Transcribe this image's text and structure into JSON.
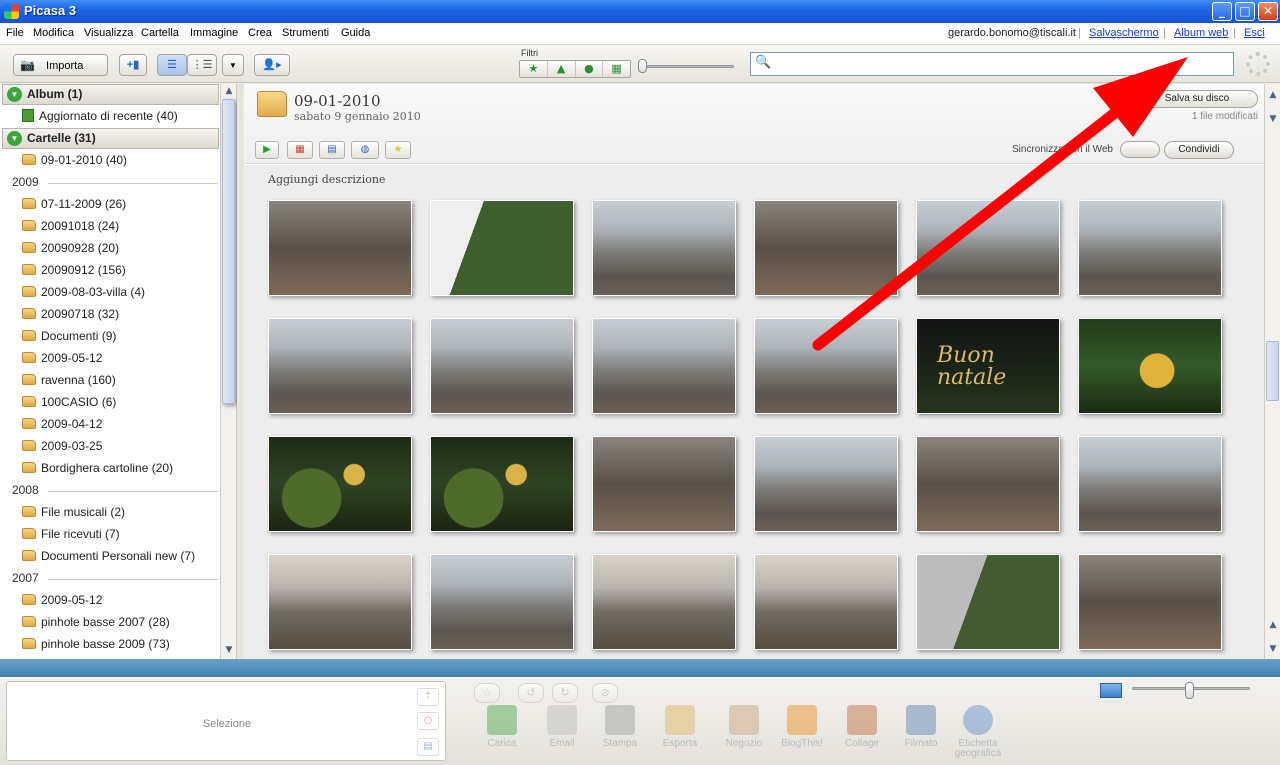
{
  "window": {
    "title": "Picasa 3",
    "minimize": "_",
    "maximize": "□",
    "close": "✕"
  },
  "menu": {
    "items": [
      "File",
      "Modifica",
      "Visualizza",
      "Cartella",
      "Immagine",
      "Crea",
      "Strumenti",
      "Guida"
    ],
    "user": "gerardo.bonomo@tiscali.it",
    "links": [
      "Salvaschermo",
      "Album web",
      "Esci"
    ],
    "separator": "|"
  },
  "toolbar": {
    "import_label": "Importa",
    "filters_label": "Filtri",
    "search": {
      "value": "",
      "placeholder": ""
    }
  },
  "sidebar": {
    "album_section": "Album (1)",
    "album_items": [
      "Aggiornato di recente (40)"
    ],
    "folders_section": "Cartelle (31)",
    "folders_top": [
      "09-01-2010 (40)"
    ],
    "year_2009": "2009",
    "folders_2009": [
      "07-11-2009 (26)",
      "20091018 (24)",
      "20090928 (20)",
      "20090912 (156)",
      "2009-08-03-villa (4)",
      "20090718 (32)",
      "Documenti (9)",
      "2009-05-12",
      "ravenna (160)",
      "100CASIO (6)",
      "2009-04-12",
      "2009-03-25",
      "Bordighera cartoline (20)"
    ],
    "year_2008": "2008",
    "folders_2008": [
      "File musicali (2)",
      "File ricevuti (7)",
      "Documenti Personali new (7)"
    ],
    "year_2007": "2007",
    "folders_2007": [
      "2009-05-12",
      "pinhole basse 2007 (28)",
      "pinhole basse 2009 (73)"
    ]
  },
  "folder": {
    "title": "09-01-2010",
    "date": "sabato 9 gennaio 2010",
    "save_label": "Salva su disco",
    "modified": "1 file modificati",
    "sync_label": "Sincronizza con il Web",
    "share_label": "Condividi",
    "add_description": "Aggiungi descrizione",
    "natale_text": "Buon natale"
  },
  "tray": {
    "selection_label": "Selezione",
    "actions": [
      "Carica",
      "Email",
      "Stampa",
      "Esporta",
      "Negozio",
      "BlogThis!",
      "Collage",
      "Filmato",
      "Etichetta geografica"
    ]
  },
  "colors": {
    "titlebar": "#1e63e3",
    "link": "#1a3bd8",
    "arrow": "#ff0000",
    "bottom_bar": "#3f7fb0"
  }
}
